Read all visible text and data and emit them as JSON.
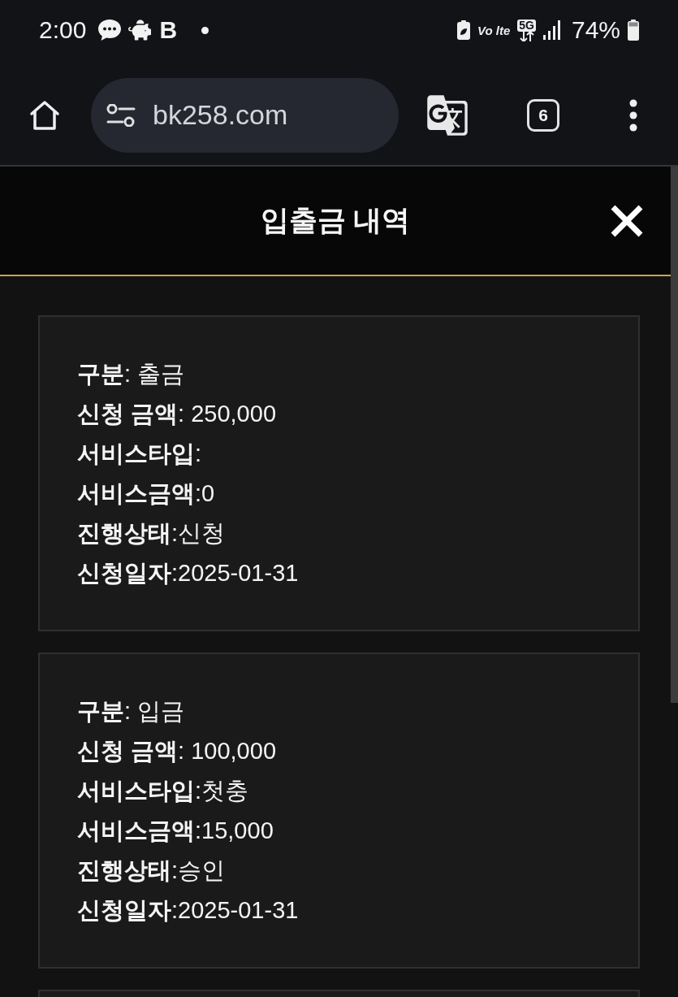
{
  "status_bar": {
    "time": "2:00",
    "app_badge": "B",
    "volte": "Vo lte",
    "network": "5G",
    "battery": "74%"
  },
  "browser": {
    "url": "bk258.com",
    "tab_count": "6"
  },
  "modal": {
    "title": "입출금 내역",
    "records": [
      {
        "lines": [
          "**구분**: 출금",
          "**신청 금액**: 250,000",
          "**서비스타입**:",
          "**서비스금액**:0",
          "**진행상태**:신청",
          "**신청일자**:2025-01-31"
        ]
      },
      {
        "lines": [
          "**구분**: 입금",
          "**신청 금액**: 100,000",
          "**서비스타입**:첫충",
          "**서비스금액**:15,000",
          "**진행상태**:승인",
          "**신청일자**:2025-01-31"
        ]
      }
    ],
    "list_continues": true
  }
}
